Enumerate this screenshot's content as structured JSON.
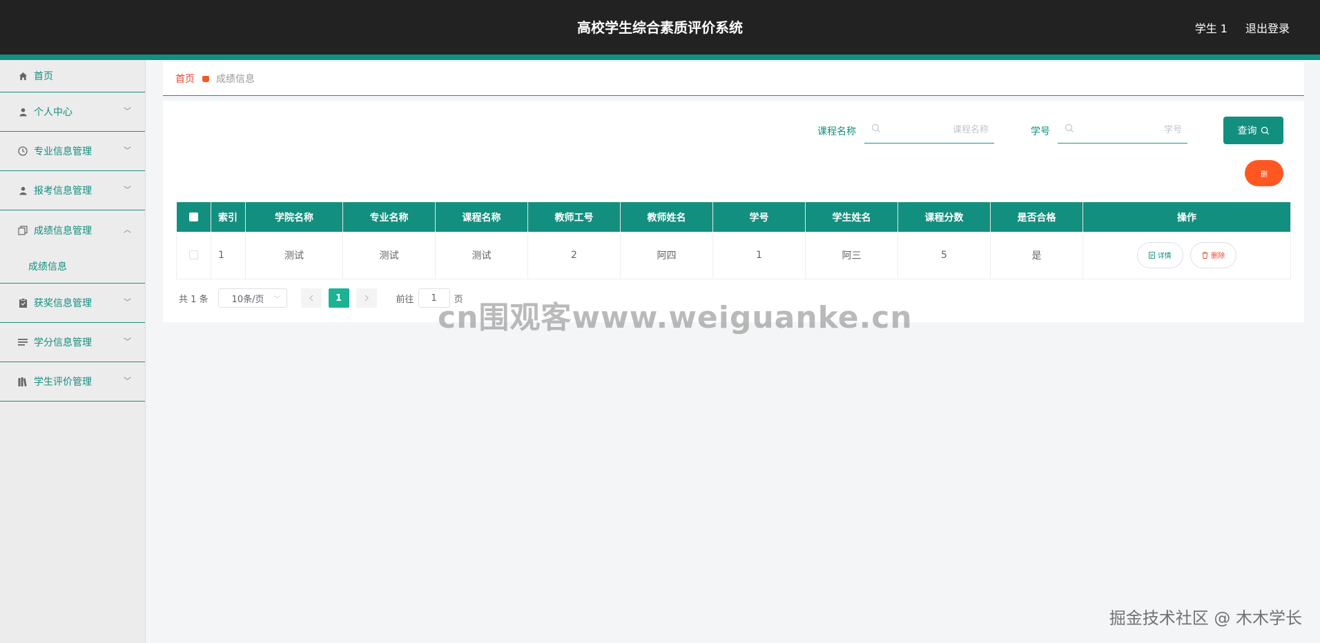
{
  "header": {
    "title": "高校学生综合素质评价系统",
    "user": "学生 1",
    "logout": "退出登录"
  },
  "sidebar": {
    "items": [
      {
        "label": "首页",
        "icon": "home-icon",
        "expanded": false
      },
      {
        "label": "个人中心",
        "icon": "user-icon",
        "expanded": false
      },
      {
        "label": "专业信息管理",
        "icon": "clock-icon",
        "expanded": false
      },
      {
        "label": "报考信息管理",
        "icon": "user-icon",
        "expanded": false
      },
      {
        "label": "成绩信息管理",
        "icon": "copy-icon",
        "expanded": true,
        "children": [
          "成绩信息"
        ]
      },
      {
        "label": "获奖信息管理",
        "icon": "clipboard-icon",
        "expanded": false
      },
      {
        "label": "学分信息管理",
        "icon": "list-icon",
        "expanded": false
      },
      {
        "label": "学生评价管理",
        "icon": "books-icon",
        "expanded": false
      }
    ]
  },
  "breadcrumb": {
    "home": "首页",
    "current": "成绩信息"
  },
  "search": {
    "course_label": "课程名称",
    "course_placeholder": "课程名称",
    "student_no_label": "学号",
    "student_no_placeholder": "学号",
    "query_button": "查询"
  },
  "delete_button": "删",
  "table": {
    "headers": [
      "",
      "索引",
      "学院名称",
      "专业名称",
      "课程名称",
      "教师工号",
      "教师姓名",
      "学号",
      "学生姓名",
      "课程分数",
      "是否合格",
      "操作"
    ],
    "rows": [
      {
        "index": "1",
        "college": "测试",
        "major": "测试",
        "course": "测试",
        "teacher_id": "2",
        "teacher_name": "阿四",
        "student_no": "1",
        "student_name": "阿三",
        "score": "5",
        "passed": "是",
        "detail_label": "详情",
        "delete_label": "删除"
      }
    ]
  },
  "pagination": {
    "total": "共 1 条",
    "page_size": "10条/页",
    "current_page": "1",
    "goto_label": "前往",
    "goto_value": "1",
    "page_suffix": "页"
  },
  "watermarks": {
    "center": "cn围观客www.weiguanke.cn",
    "corner": "掘金技术社区 @ 木木学长"
  },
  "colors": {
    "header_bg": "#222222",
    "primary": "#138f7f",
    "danger": "#ff5722",
    "active_page": "#1ab394"
  }
}
